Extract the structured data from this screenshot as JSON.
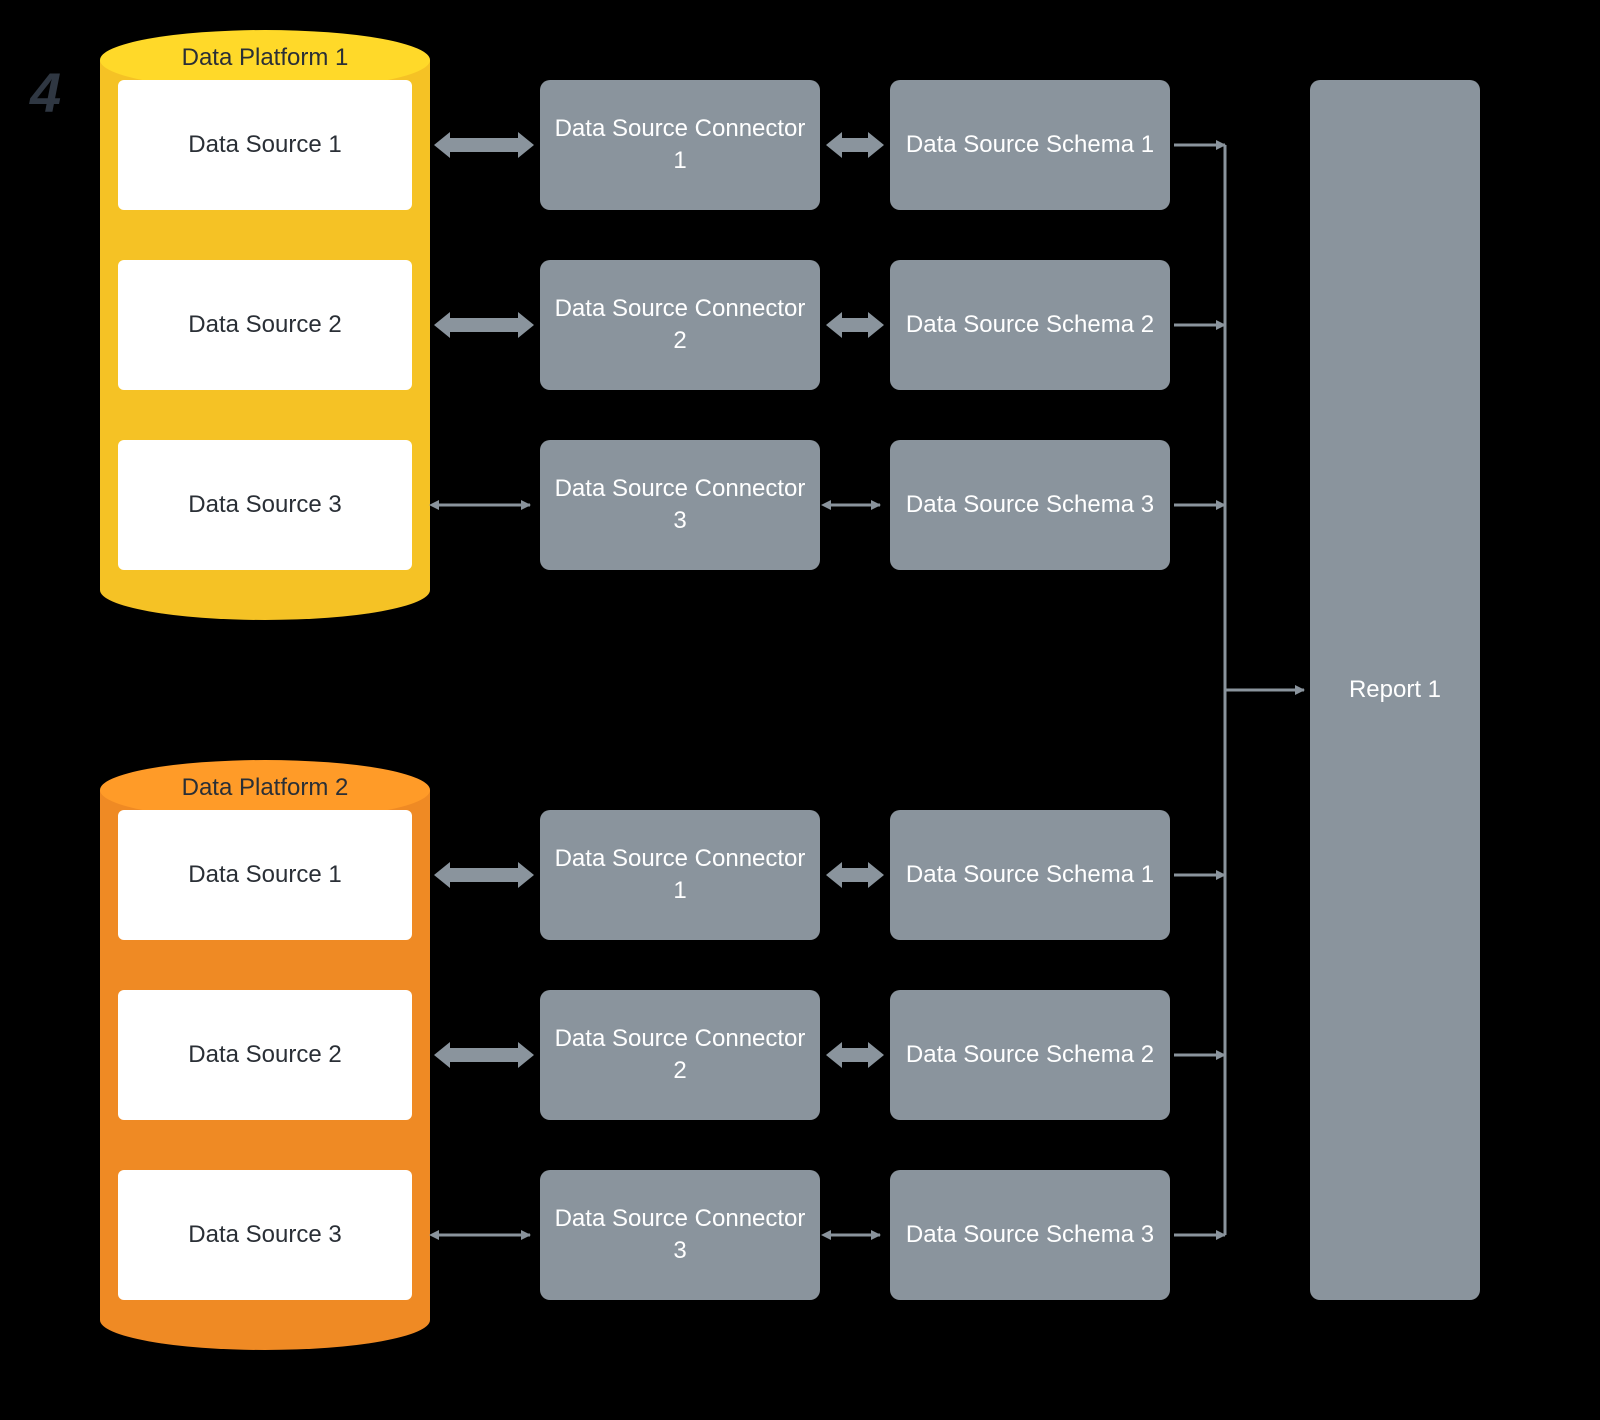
{
  "watermark": "4",
  "platforms": [
    {
      "title": "Data Platform 1",
      "color": "#f5c225",
      "sources": [
        "Data Source 1",
        "Data Source 2",
        "Data Source 3"
      ]
    },
    {
      "title": "Data Platform 2",
      "color": "#ef8a24",
      "sources": [
        "Data Source 1",
        "Data Source 2",
        "Data Source 3"
      ]
    }
  ],
  "connectors": [
    "Data Source Connector 1",
    "Data Source Connector 2",
    "Data Source Connector 3",
    "Data Source Connector 1",
    "Data Source Connector 2",
    "Data Source Connector 3"
  ],
  "schemas": [
    "Data Source Schema 1",
    "Data Source Schema 2",
    "Data Source Schema 3",
    "Data Source Schema 1",
    "Data Source Schema 2",
    "Data Source Schema 3"
  ],
  "report": "Report 1",
  "arrowColor": "#8a949d",
  "arrowThinColor": "#8a949d"
}
